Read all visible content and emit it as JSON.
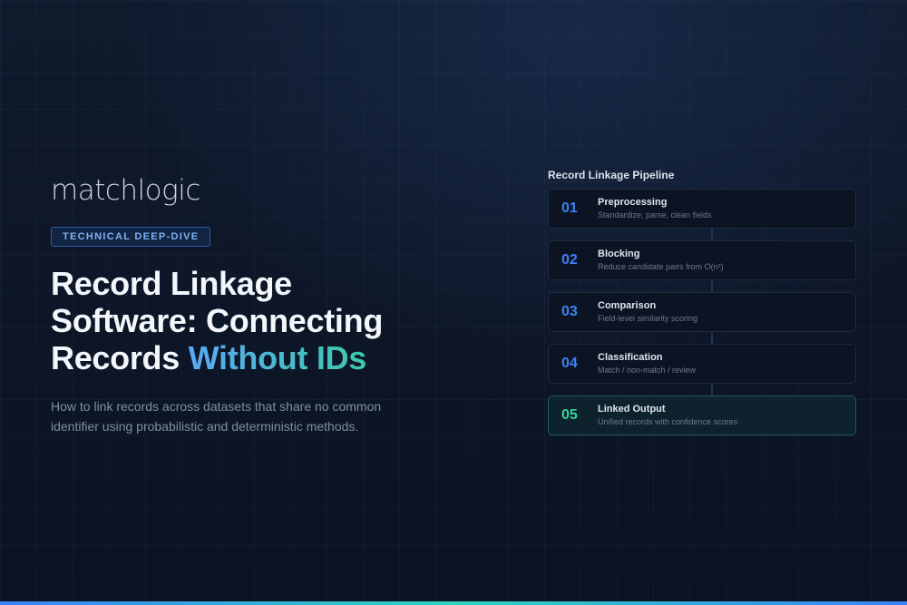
{
  "brand": {
    "logo_text": "matchlogic"
  },
  "hero": {
    "badge": "TECHNICAL DEEP-DIVE",
    "title_line1": "Record Linkage",
    "title_line2": "Software: Connecting",
    "title_line3_plain": "Records ",
    "title_line3_accent": "Without IDs",
    "subtitle": "How to link records across datasets that share no common identifier using probabilistic and deterministic methods."
  },
  "pipeline": {
    "title": "Record Linkage Pipeline",
    "steps": [
      {
        "num": "01",
        "name": "Preprocessing",
        "desc": "Standardize, parse, clean fields"
      },
      {
        "num": "02",
        "name": "Blocking",
        "desc": "Reduce candidate pairs from O(n²)"
      },
      {
        "num": "03",
        "name": "Comparison",
        "desc": "Field-level similarity scoring"
      },
      {
        "num": "04",
        "name": "Classification",
        "desc": "Match / non-match / review"
      },
      {
        "num": "05",
        "name": "Linked Output",
        "desc": "Unified records with confidence scores"
      }
    ]
  },
  "colors": {
    "background": "#0d1627",
    "accent_blue": "#3b82f6",
    "accent_teal": "#34d399",
    "title_gradient_start": "#5aa9f5",
    "title_gradient_end": "#3ec9a9"
  }
}
